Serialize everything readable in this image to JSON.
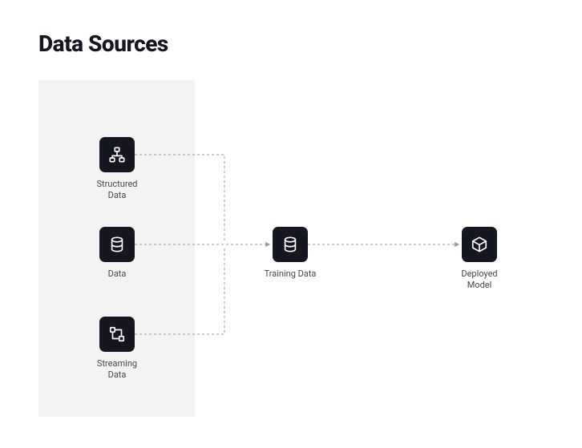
{
  "title": "Data Sources",
  "nodes": {
    "structured": {
      "label": "Structured\nData"
    },
    "data": {
      "label": "Data"
    },
    "streaming": {
      "label": "Streaming\nData"
    },
    "training": {
      "label": "Training Data"
    },
    "deployed": {
      "label": "Deployed\nModel"
    }
  },
  "colors": {
    "node_bg": "#14171f",
    "panel_bg": "#f3f3f3",
    "connector": "#9497a1"
  }
}
